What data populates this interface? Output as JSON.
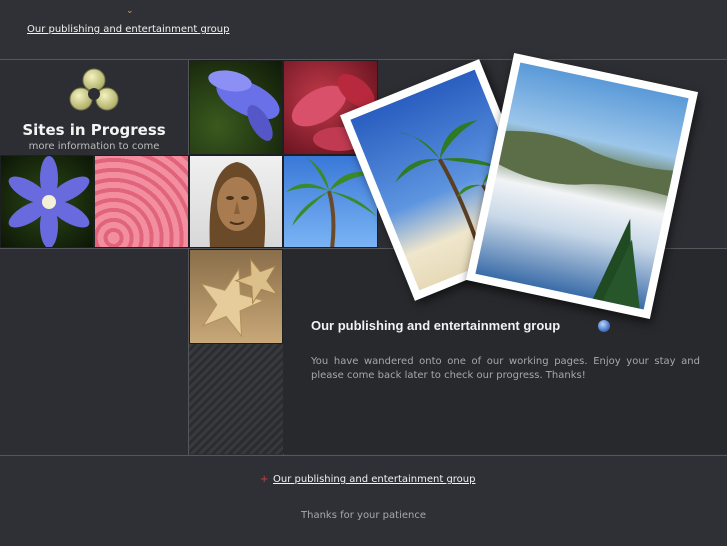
{
  "header": {
    "link_text": "Our publishing and entertainment group"
  },
  "logo": {
    "title": "Sites in Progress",
    "subtitle": "more information to come"
  },
  "main": {
    "heading": "Our publishing and entertainment group",
    "paragraph": "You have wandered onto one of our working pages. Enjoy your stay and please come back later to check our progress. Thanks!"
  },
  "footer": {
    "link_text": "Our publishing and entertainment group",
    "thanks": "Thanks for your patience"
  },
  "colors": {
    "background": "#2d2e33",
    "accent": "#e0a020",
    "bullet": "#d04040"
  },
  "icons": [
    "chevron-down-icon",
    "logo-trefoil-icon",
    "info-icon",
    "bullet-icon"
  ]
}
